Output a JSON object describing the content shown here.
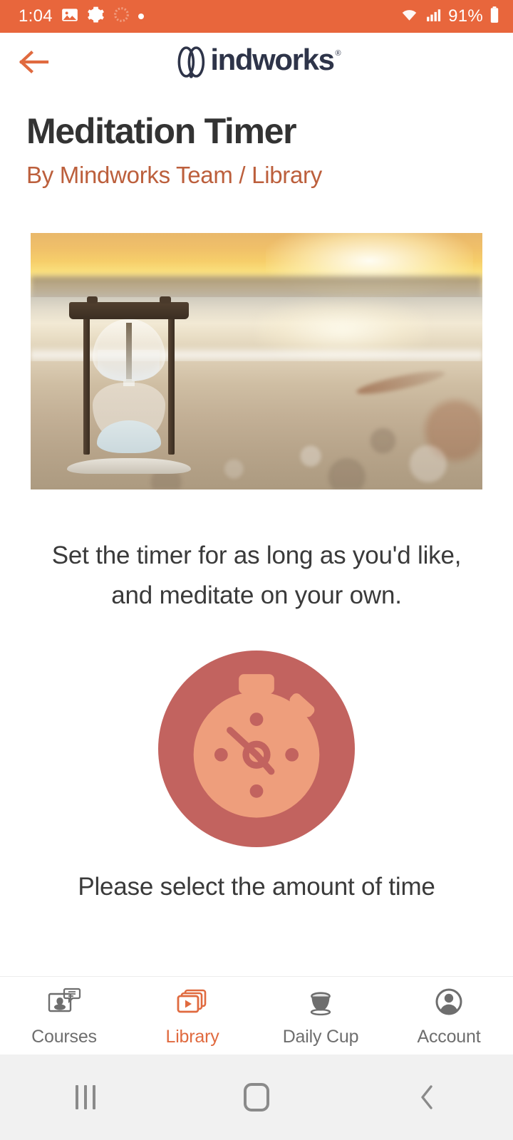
{
  "status_bar": {
    "time": "1:04",
    "battery_percent": "91%",
    "left_icons": [
      "image-icon",
      "gear-icon",
      "spinner-icon",
      "dot-indicator"
    ],
    "right_icons": [
      "wifi-icon",
      "cellular-signal-icon",
      "battery-icon"
    ],
    "background_color": "#E8663C"
  },
  "header": {
    "back_label": "Back",
    "brand_name": "indworks",
    "brand_mark": "M",
    "trademark": "®",
    "brand_color": "#2E3449",
    "accent_color": "#E06A3F"
  },
  "page": {
    "title": "Meditation Timer",
    "subtitle": "By Mindworks Team / Library",
    "subtitle_color": "#BC5F3C",
    "hero_image_alt": "hourglass-on-beach-at-sunset",
    "description": "Set the timer for as long as you'd like, and meditate on your own.",
    "prompt": "Please select the amount of time",
    "badge": {
      "icon": "stopwatch-icon",
      "circle_color": "#C2635F",
      "face_color": "#EE9E7C"
    }
  },
  "tabbar": {
    "items": [
      {
        "label": "Courses",
        "icon": "courses-icon",
        "active": false
      },
      {
        "label": "Library",
        "icon": "library-icon",
        "active": true
      },
      {
        "label": "Daily Cup",
        "icon": "daily-cup-icon",
        "active": false
      },
      {
        "label": "Account",
        "icon": "account-icon",
        "active": false
      }
    ],
    "active_color": "#E06A3F",
    "inactive_color": "#6E6E6E"
  },
  "system_nav": {
    "recents_label": "Recents",
    "home_label": "Home",
    "back_label": "Back"
  }
}
